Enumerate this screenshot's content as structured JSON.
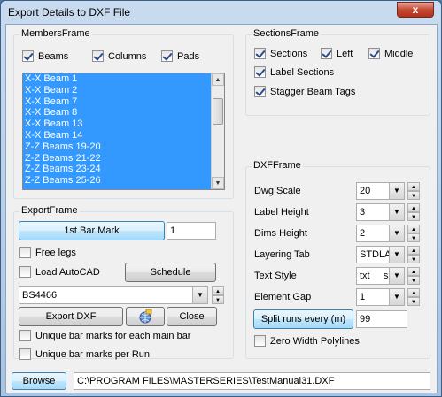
{
  "window": {
    "title": "Export Details to DXF File",
    "close_glyph": "x"
  },
  "members": {
    "frame_title": "MembersFrame",
    "beams": {
      "label": "Beams",
      "checked": true
    },
    "columns": {
      "label": "Columns",
      "checked": true
    },
    "pads": {
      "label": "Pads",
      "checked": true
    },
    "list_items": [
      "X-X Beam 1",
      "X-X Beam 2",
      "X-X Beam 7",
      "X-X Beam 8",
      "X-X Beam 13",
      "X-X Beam 14",
      "Z-Z Beams 19-20",
      "Z-Z Beams 21-22",
      "Z-Z Beams 23-24",
      "Z-Z Beams 25-26"
    ]
  },
  "sections": {
    "frame_title": "SectionsFrame",
    "sections": {
      "label": "Sections",
      "checked": true
    },
    "left": {
      "label": "Left",
      "checked": true
    },
    "middle": {
      "label": "Middle",
      "checked": true
    },
    "label_sections": {
      "label": "Label Sections",
      "checked": true
    },
    "stagger": {
      "label": "Stagger Beam Tags",
      "checked": true
    }
  },
  "export": {
    "frame_title": "ExportFrame",
    "first_bar_mark_label": "1st Bar Mark",
    "first_bar_mark_value": "1",
    "free_legs": {
      "label": "Free legs",
      "checked": false
    },
    "load_autocad": {
      "label": "Load AutoCAD",
      "checked": false
    },
    "schedule_label": "Schedule",
    "standard_value": "BS4466",
    "export_dxf_label": "Export DXF",
    "close_label": "Close",
    "unique_main": {
      "label": "Unique bar marks for each main bar",
      "checked": false
    },
    "unique_run": {
      "label": "Unique bar marks per Run",
      "checked": false
    }
  },
  "dxf": {
    "frame_title": "DXFFrame",
    "rows": [
      {
        "label": "Dwg Scale",
        "value": "20"
      },
      {
        "label": "Label Height",
        "value": "3"
      },
      {
        "label": "Dims Height",
        "value": "2"
      },
      {
        "label": "Layering Tab",
        "value": "STDLAY"
      },
      {
        "label": "Text Style",
        "value": "txt     s"
      },
      {
        "label": "Element Gap",
        "value": "1"
      }
    ],
    "split_runs_label": "Split runs every (m)",
    "split_runs_value": "99",
    "zero_width": {
      "label": "Zero Width Polylines",
      "checked": false
    }
  },
  "footer": {
    "browse_label": "Browse",
    "path_value": "C:\\PROGRAM FILES\\MASTERSERIES\\TestManual31.DXF"
  }
}
